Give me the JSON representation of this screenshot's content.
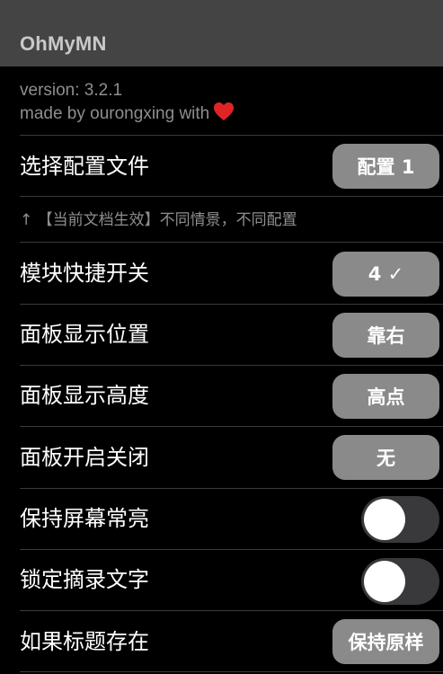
{
  "header": {
    "title": "OhMyMN"
  },
  "info": {
    "version": "version: 3.2.1",
    "author": "made by ourongxing with"
  },
  "settings": {
    "profile": {
      "label": "选择配置文件",
      "value": "配置 1"
    },
    "profile_note": "↑ 【当前文档生效】不同情景，不同配置",
    "module_switch": {
      "label": "模块快捷开关",
      "value": "4 ✓"
    },
    "panel_position": {
      "label": "面板显示位置",
      "value": "靠右"
    },
    "panel_height": {
      "label": "面板显示高度",
      "value": "高点"
    },
    "panel_toggle": {
      "label": "面板开启关闭",
      "value": "无"
    },
    "keep_screen_on": {
      "label": "保持屏幕常亮",
      "enabled": false
    },
    "lock_excerpt": {
      "label": "锁定摘录文字",
      "enabled": false
    },
    "title_exists": {
      "label": "如果标题存在",
      "value": "保持原样"
    }
  },
  "colors": {
    "background": "#000000",
    "titlebar": "#444444",
    "button": "#8a8a8a",
    "toggle_off": "#39393b",
    "heart": "#e02424"
  },
  "icons": {
    "heart": "heart-icon"
  }
}
